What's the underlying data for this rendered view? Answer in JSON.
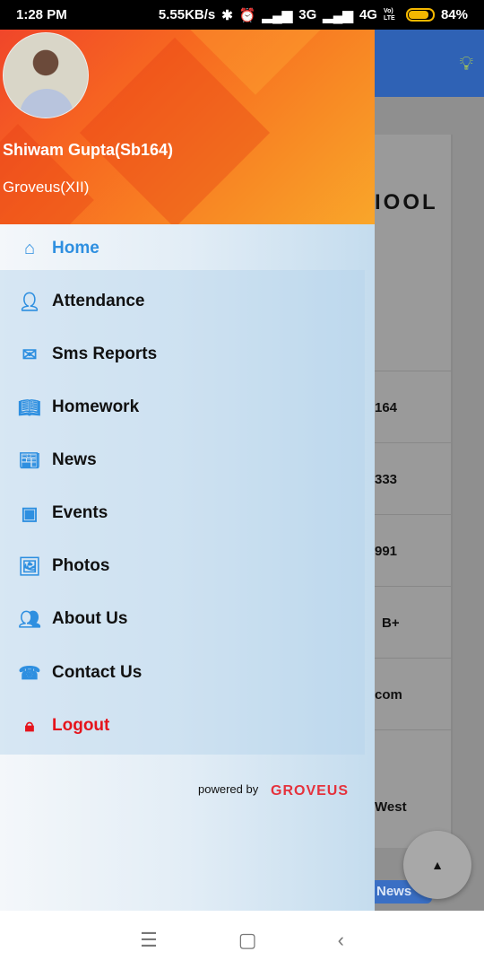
{
  "status": {
    "time": "1:28 PM",
    "speed": "5.55KB/s",
    "net1": "3G",
    "net2": "4G",
    "volte": "Vo) LTE",
    "battery": "84%",
    "battery_level": 0.84
  },
  "background": {
    "school": "IOOL",
    "rows": [
      "164",
      "333",
      "991",
      "B+",
      "com",
      "",
      "West"
    ],
    "news_button": "News"
  },
  "drawer": {
    "user_name": "Shiwam Gupta(Sb164)",
    "user_class": "Groveus(XII)",
    "items": [
      {
        "label": "Home",
        "icon": "home-icon"
      },
      {
        "label": "Attendance",
        "icon": "person-icon"
      },
      {
        "label": "Sms Reports",
        "icon": "mail-icon"
      },
      {
        "label": "Homework",
        "icon": "book-icon"
      },
      {
        "label": "News",
        "icon": "newspaper-icon"
      },
      {
        "label": "Events",
        "icon": "calendar-icon"
      },
      {
        "label": "Photos",
        "icon": "photos-icon"
      },
      {
        "label": "About Us",
        "icon": "people-icon"
      },
      {
        "label": "Contact Us",
        "icon": "phone-icon"
      },
      {
        "label": "Logout",
        "icon": "lock-icon"
      }
    ],
    "powered_by": "powered by",
    "brand": "GROVEUS"
  },
  "colors": {
    "accent": "#2e8fe0",
    "logout": "#e5141c",
    "appbar": "#2f62b5"
  }
}
